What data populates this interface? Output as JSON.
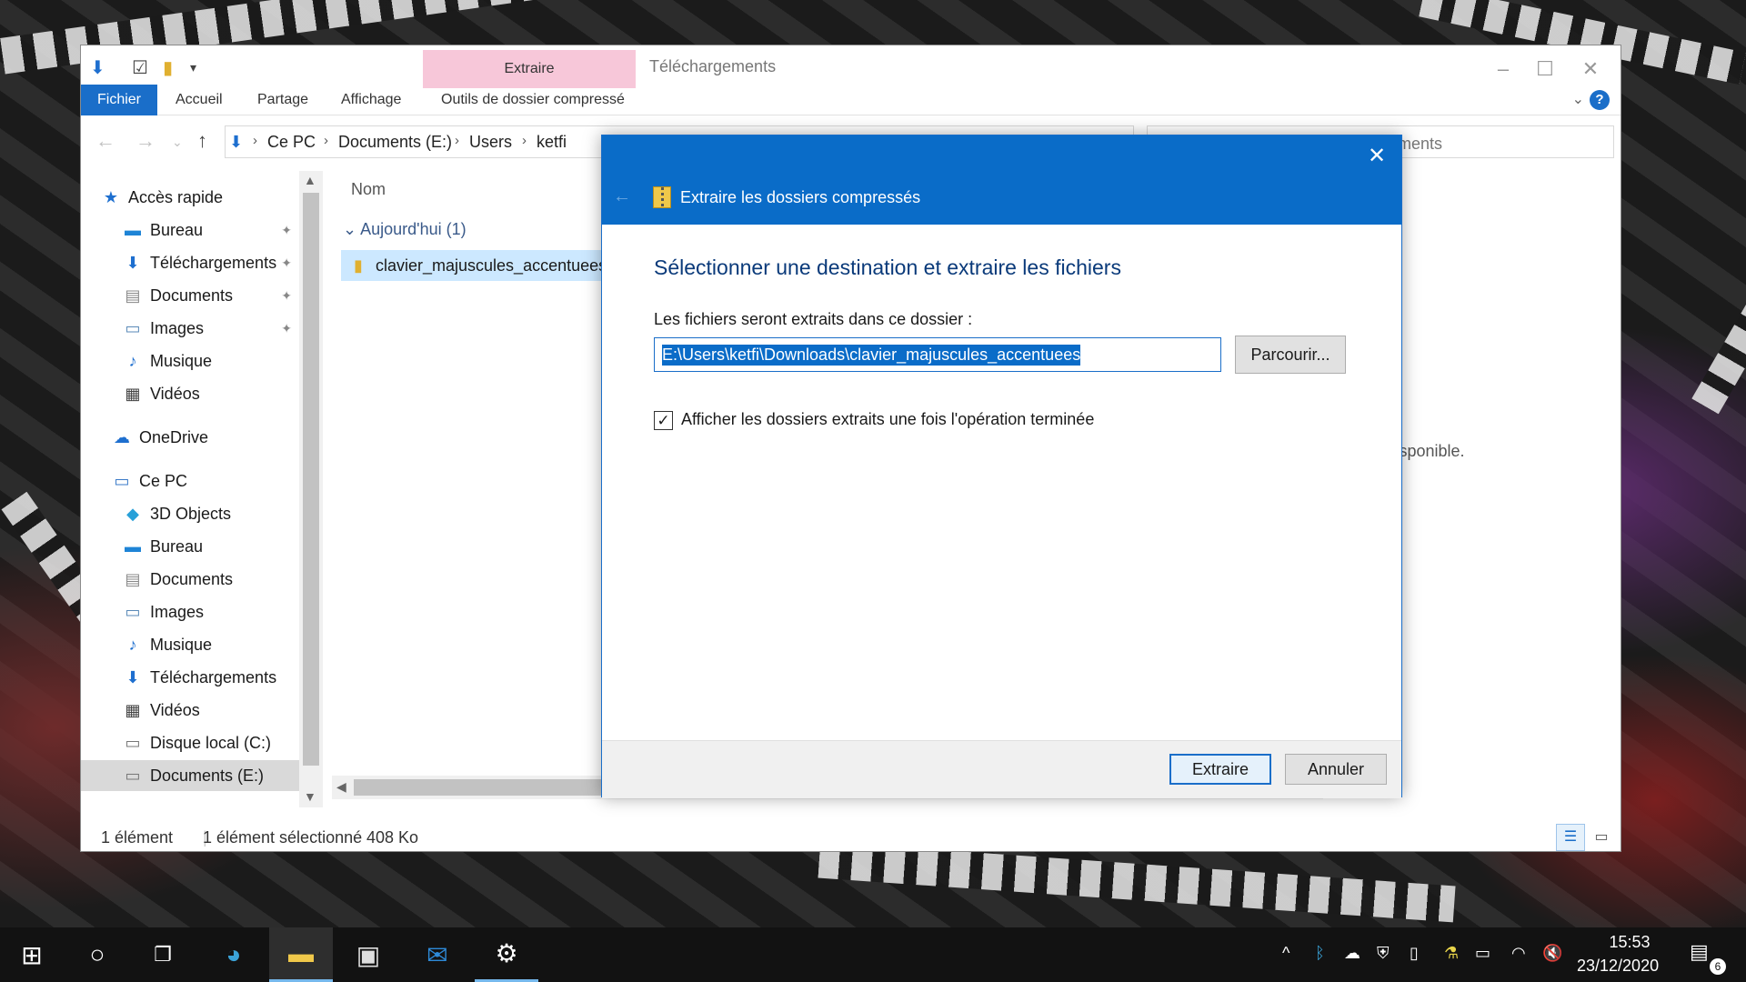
{
  "window": {
    "title": "Téléchargements",
    "context_tab": "Extraire",
    "ribbon_tabs": [
      "Fichier",
      "Accueil",
      "Partage",
      "Affichage",
      "Outils de dossier compressé"
    ]
  },
  "address": {
    "breadcrumbs": [
      "Ce PC",
      "Documents (E:)",
      "Users",
      "ketfi"
    ],
    "search_placeholder_visible": "ments"
  },
  "nav": {
    "quick_access": "Accès rapide",
    "quick_items": [
      "Bureau",
      "Téléchargements",
      "Documents",
      "Images",
      "Musique",
      "Vidéos"
    ],
    "onedrive": "OneDrive",
    "this_pc": "Ce PC",
    "pc_items": [
      "3D Objects",
      "Bureau",
      "Documents",
      "Images",
      "Musique",
      "Téléchargements",
      "Vidéos",
      "Disque local (C:)",
      "Documents (E:)"
    ]
  },
  "files": {
    "column_name": "Nom",
    "group": "Aujourd'hui (1)",
    "items": [
      "clavier_majuscules_accentuees"
    ],
    "preview_text": "rçu n'est disponible."
  },
  "status": {
    "count": "1 élément",
    "selected": "1 élément sélectionné",
    "size": "408 Ko"
  },
  "dialog": {
    "title": "Extraire les dossiers compressés",
    "heading": "Sélectionner une destination et extraire les fichiers",
    "dest_label": "Les fichiers seront extraits dans ce dossier :",
    "dest_path": "E:\\Users\\ketfi\\Downloads\\clavier_majuscules_accentuees",
    "browse_label": "Parcourir...",
    "checkbox_label": "Afficher les dossiers extraits une fois l'opération terminée",
    "checkbox_checked": true,
    "extract_label": "Extraire",
    "cancel_label": "Annuler"
  },
  "taskbar": {
    "time": "15:53",
    "date": "23/12/2020",
    "notifications": "6"
  },
  "colors": {
    "accent": "#0a6cc8",
    "context_tab": "#f7c7d9",
    "selection": "#cce8ff"
  }
}
